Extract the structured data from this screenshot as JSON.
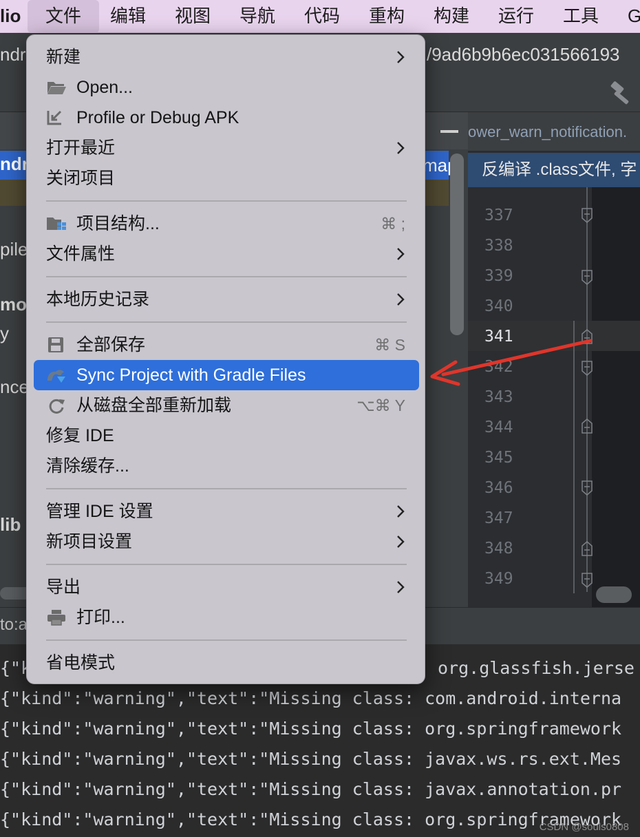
{
  "menubar": {
    "app_name": "lio",
    "items": [
      "文件",
      "编辑",
      "视图",
      "导航",
      "代码",
      "重构",
      "构建",
      "运行",
      "工具",
      "G"
    ]
  },
  "path_bar": {
    "text": "ndr",
    "hash": "/9ad6b9b6ec031566193"
  },
  "editor": {
    "tab_label": "ower_warn_notification.",
    "banner": "反编译 .class文件, 字",
    "line_numbers": [
      "337",
      "338",
      "339",
      "340",
      "341",
      "342",
      "343",
      "344",
      "345",
      "346",
      "347",
      "348",
      "349"
    ],
    "current_line": "341"
  },
  "project_panel": {
    "rows": [
      "ndro",
      "map",
      "pile",
      "mor",
      "y",
      "nce",
      "lib"
    ]
  },
  "status_strip": {
    "text": "to:a"
  },
  "file_menu": {
    "items": [
      {
        "label": "新建",
        "submenu": true
      },
      {
        "label": "Open...",
        "icon": "folder-open-icon"
      },
      {
        "label": "Profile or Debug APK",
        "icon": "profile-debug-apk-icon"
      },
      {
        "label": "打开最近",
        "submenu": true
      },
      {
        "label": "关闭项目"
      },
      {
        "label": "项目结构...",
        "icon": "project-structure-icon",
        "shortcut": "⌘ ;"
      },
      {
        "label": "文件属性",
        "submenu": true
      },
      {
        "label": "本地历史记录",
        "submenu": true
      },
      {
        "label": "全部保存",
        "icon": "save-all-icon",
        "shortcut": "⌘ S"
      },
      {
        "label": "Sync Project with Gradle Files",
        "icon": "gradle-sync-icon",
        "highlighted": true
      },
      {
        "label": "从磁盘全部重新加载",
        "icon": "reload-icon",
        "shortcut": "⌥⌘ Y"
      },
      {
        "label": "修复 IDE"
      },
      {
        "label": "清除缓存..."
      },
      {
        "label": "管理 IDE 设置",
        "submenu": true
      },
      {
        "label": "新项目设置",
        "submenu": true
      },
      {
        "label": "导出",
        "submenu": true
      },
      {
        "label": "打印...",
        "icon": "print-icon"
      },
      {
        "label": "省电模式"
      }
    ]
  },
  "console": {
    "lines": [
      "{\"ki",
      "{\"kind\":\"warning\",\"text\":\"Missing class: com.android.interna",
      "{\"kind\":\"warning\",\"text\":\"Missing class: org.springframework",
      "{\"kind\":\"warning\",\"text\":\"Missing class: javax.ws.rs.ext.Mes",
      "{\"kind\":\"warning\",\"text\":\"Missing class: javax.annotation.pr",
      "{\"kind\":\"warning\",\"text\":\"Missing class: org.springframework"
    ],
    "partial_right": "org.glassfish.jerse"
  },
  "watermark": "CSDN @souls0808",
  "colors": {
    "menubar_bg": "#e9d4ee",
    "menu_bg": "#c9c6ce",
    "highlight": "#2e6fdb",
    "annotation_arrow": "#e0352b"
  }
}
